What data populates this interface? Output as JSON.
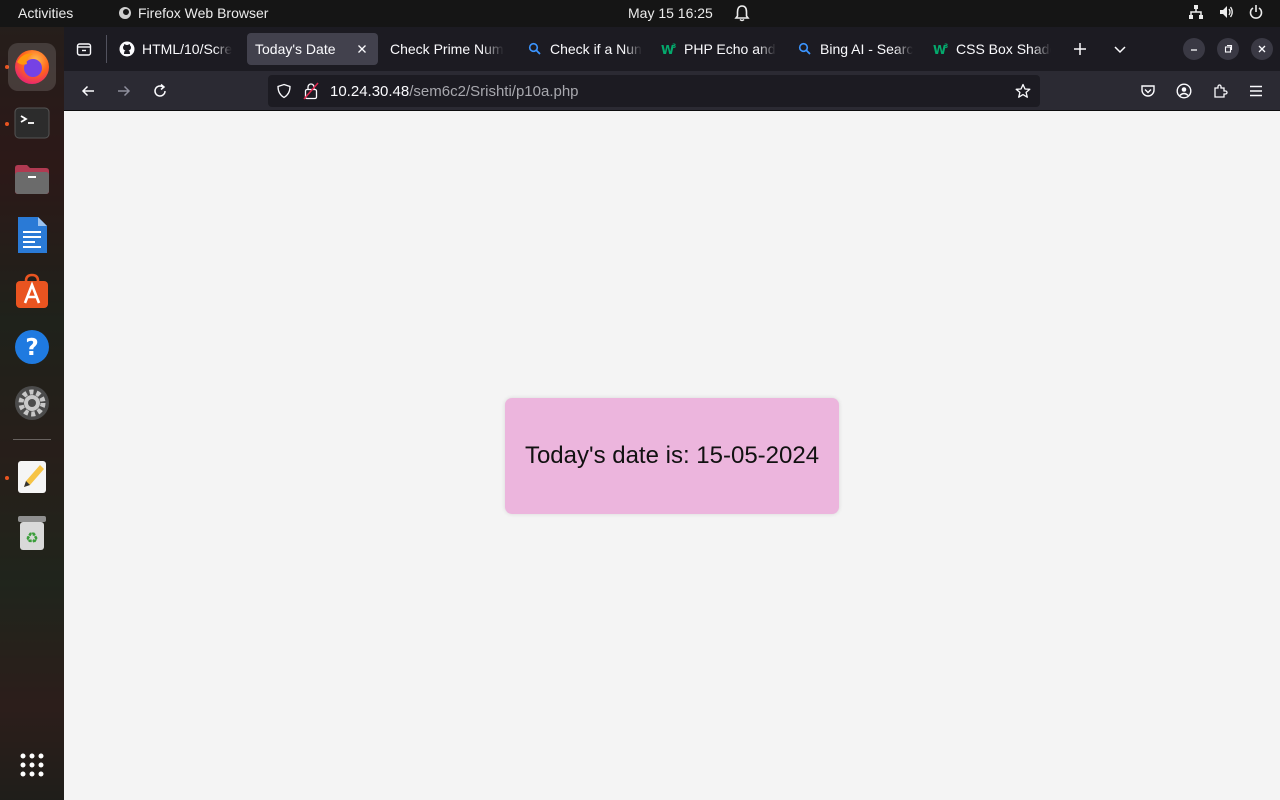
{
  "topbar": {
    "activities": "Activities",
    "app_name": "Firefox Web Browser",
    "datetime": "May 15  16:25"
  },
  "dock": {
    "items": [
      {
        "name": "firefox-icon",
        "running": true,
        "active": true
      },
      {
        "name": "terminal-icon",
        "running": true
      },
      {
        "name": "files-icon",
        "running": false
      },
      {
        "name": "libreoffice-writer-icon",
        "running": false
      },
      {
        "name": "app-center-icon",
        "running": false
      },
      {
        "name": "help-icon",
        "running": false
      },
      {
        "name": "settings-icon",
        "running": false
      },
      {
        "name": "text-editor-icon",
        "running": true
      },
      {
        "name": "trash-icon",
        "running": false
      },
      {
        "name": "show-apps-icon",
        "running": false
      }
    ]
  },
  "tabs": [
    {
      "label": "HTML/10/Scre",
      "icon": "github-icon",
      "selected": false
    },
    {
      "label": "Today's Date",
      "icon": "",
      "selected": true
    },
    {
      "label": "Check Prime Num",
      "icon": "",
      "selected": false
    },
    {
      "label": "Check if a Nun",
      "icon": "search-icon",
      "selected": false
    },
    {
      "label": "PHP Echo and",
      "icon": "w3-icon",
      "selected": false
    },
    {
      "label": "Bing AI - Searc",
      "icon": "search-icon",
      "selected": false
    },
    {
      "label": "CSS Box Shadc",
      "icon": "w3-icon",
      "selected": false
    }
  ],
  "urlbar": {
    "host": "10.24.30.48",
    "path": "/sem6c2/Srishti/p10a.php"
  },
  "page": {
    "date_text": "Today's date is: 15-05-2024",
    "box_color": "#ecb5dd",
    "background": "#f4f4f4"
  }
}
